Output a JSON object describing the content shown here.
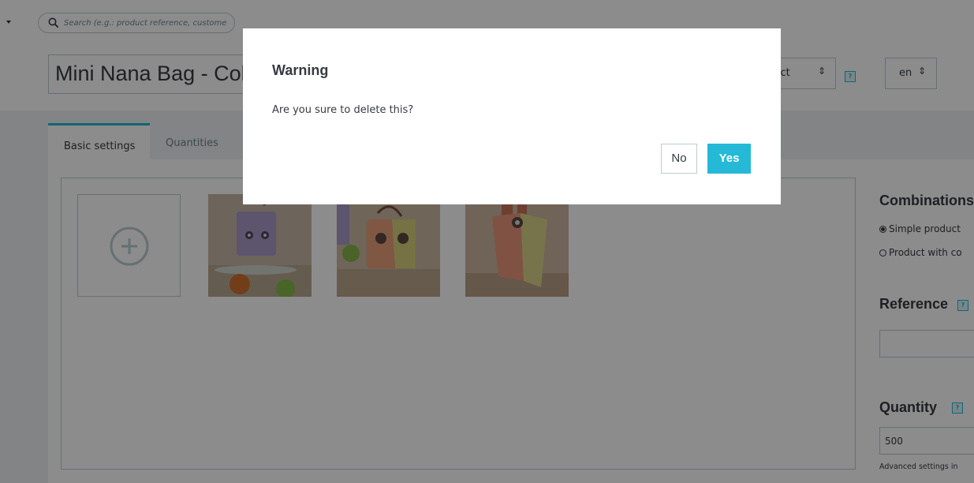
{
  "header": {
    "search_placeholder": "Search (e.g.: product reference, custome",
    "product_name": "Mini Nana Bag - Color",
    "product_type_label": "duct",
    "help_label": "?",
    "language": "en"
  },
  "tabs": [
    {
      "label": "Basic settings",
      "active": true
    },
    {
      "label": "Quantities",
      "active": false
    }
  ],
  "images": {
    "add_label": "+",
    "thumbnails": [
      "bag-lavender",
      "bag-peach",
      "bag-coral"
    ]
  },
  "sidebar": {
    "combinations_title": "Combinations",
    "simple_product_label": "Simple product",
    "product_with_combinations_label": "Product with co",
    "reference_title": "Reference",
    "reference_value": "",
    "quantity_title": "Quantity",
    "quantity_value": "500",
    "advanced_settings_text": "Advanced settings in"
  },
  "modal": {
    "title": "Warning",
    "message": "Are you sure to delete this?",
    "no_label": "No",
    "yes_label": "Yes"
  },
  "colors": {
    "accent": "#25b9d7",
    "border": "#bbcdd2",
    "text": "#363a41",
    "background": "#eff1f2"
  }
}
